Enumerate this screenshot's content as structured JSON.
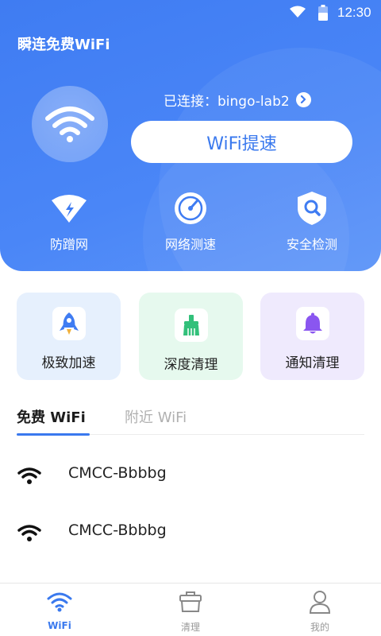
{
  "status_bar": {
    "time": "12:30"
  },
  "app": {
    "title": "瞬连免费WiFi"
  },
  "connection": {
    "label": "已连接：bingo-lab2"
  },
  "boost_button": {
    "label": "WiFi提速"
  },
  "tools": [
    {
      "label": "防蹭网",
      "icon": "shield-wifi-icon"
    },
    {
      "label": "网络测速",
      "icon": "speedometer-icon"
    },
    {
      "label": "安全检测",
      "icon": "security-scan-icon"
    }
  ],
  "cards": [
    {
      "label": "极致加速",
      "icon": "rocket-icon",
      "bg": "#e6f0fd"
    },
    {
      "label": "深度清理",
      "icon": "broom-icon",
      "bg": "#e6f9ee"
    },
    {
      "label": "通知清理",
      "icon": "bell-icon",
      "bg": "#efeafd"
    }
  ],
  "tabs": {
    "free": "免费 WiFi",
    "nearby": "附近 WiFi"
  },
  "networks": [
    {
      "name": "CMCC-Bbbbg"
    },
    {
      "name": "CMCC-Bbbbg"
    }
  ],
  "bottom_nav": [
    {
      "label": "WiFi",
      "icon": "wifi-icon",
      "active": true
    },
    {
      "label": "清理",
      "icon": "clean-bag-icon",
      "active": false
    },
    {
      "label": "我的",
      "icon": "user-icon",
      "active": false
    }
  ],
  "colors": {
    "brand_blue": "#3f7cf2",
    "accent": "#3a79ee"
  }
}
